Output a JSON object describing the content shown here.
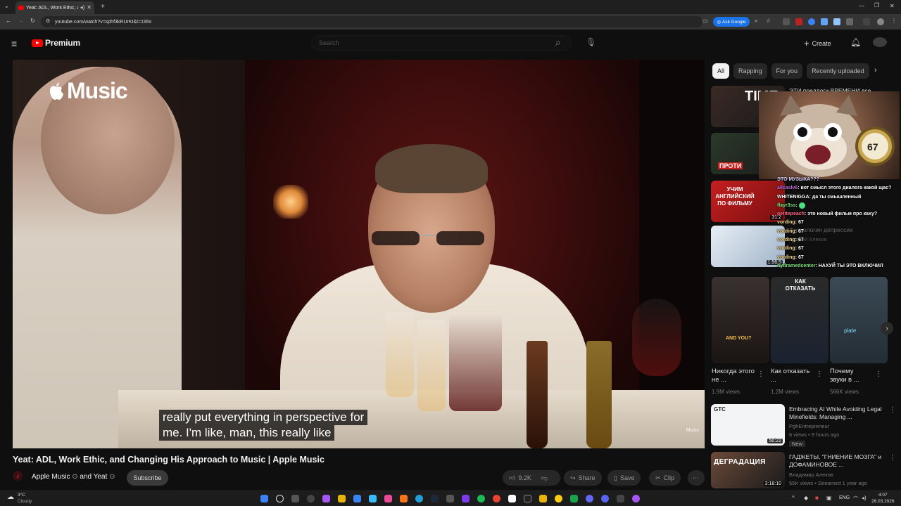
{
  "browser": {
    "tab_title": "Yeat: ADL, Work Ethic, and",
    "url": "youtube.com/watch?v=sphf3kRUrKI&t=195s",
    "ask_google": "Ask Google",
    "new_tab": "+"
  },
  "youtube": {
    "logo_text": "Premium",
    "search_placeholder": "Search",
    "create_label": "Create"
  },
  "player": {
    "overlay_brand": "Music",
    "corner_brand": "Music",
    "caption_line1": "really put everything in perspective for",
    "caption_line2": "me. I'm like, man, this really like"
  },
  "video": {
    "title": "Yeat: ADL, Work Ethic, and Changing His Approach to Music | Apple Music",
    "channel": "Apple Music",
    "collab": "and Yeat",
    "subscribe_label": "Subscribe",
    "likes": "9.2K",
    "share_label": "Share",
    "save_label": "Save",
    "clip_label": "Clip"
  },
  "chips": [
    "All",
    "Rapping",
    "For you",
    "Recently uploaded"
  ],
  "recommendations_top": [
    {
      "title": "ЭТИ предлоги ВРЕМЕНИ все",
      "thumb_text": "TIME"
    },
    {
      "title": "",
      "thumb_text": "ПРОТИ"
    },
    {
      "title": "",
      "thumb_text": "УЧИМ АНГЛИЙСКИЙ ПО ФИЛЬМУ",
      "duration": "31:2"
    },
    {
      "title": "Физиология депрессии",
      "meta": "Андрей Алеков",
      "duration": "1:56:5"
    }
  ],
  "chat": {
    "header": "ЭТО МУЗЫКА???",
    "messages": [
      {
        "user": "allcaslv6",
        "text": "вот смысл этого диалога какой щас?",
        "color": "#c66adf"
      },
      {
        "user": "WHITENIGGA",
        "text": "да ты смышленный",
        "color": "#ffffff"
      },
      {
        "user": "flayr3ss",
        "text": "",
        "color": "#7fe57f"
      },
      {
        "user": "petitepeach",
        "text": "это новый фильм про каху?",
        "color": "#ff6a8c"
      },
      {
        "user": "vording",
        "text": "67",
        "color": "#f5d78a"
      },
      {
        "user": "vording",
        "text": "67",
        "color": "#f5d78a"
      },
      {
        "user": "vording",
        "text": "67",
        "color": "#f5d78a"
      },
      {
        "user": "vording",
        "text": "67",
        "color": "#f5d78a"
      },
      {
        "user": "vording",
        "text": "67",
        "color": "#f5d78a"
      },
      {
        "user": "hydramedcenter",
        "text": "НАХУЙ ТЫ ЭТО ВКЛЮЧИЛ",
        "color": "#7fe57f"
      }
    ]
  },
  "shorts": [
    {
      "title": "Никогда этого не ...",
      "views": "1.9M views",
      "overlay": "AND YOU?"
    },
    {
      "title": "Как отказать ...",
      "views": "1.2M views",
      "overlay": "КАК ОТКАЗАТЬ"
    },
    {
      "title": "Почему звуки в ...",
      "views": "566K views",
      "overlay": "plate"
    }
  ],
  "recommendations_bottom": [
    {
      "title": "Embracing AI While Avoiding Legal Minefields: Managing ...",
      "channel": "PghEntrepreneur",
      "meta": "6 views • 9 hours ago",
      "badge": "New",
      "duration": "50:22",
      "thumb_text": "GTC"
    },
    {
      "title": "ГАДЖЕТЫ, \"ГНИЕНИЕ МОЗГА\" и ДОФАМИНОВОЕ ...",
      "channel": "Владимир Алеков",
      "meta": "55K views • Streamed 1 year ago",
      "duration": "3:18:10",
      "thumb_text": "ДЕГРАДАЦИЯ"
    }
  ],
  "taskbar": {
    "weather_temp": "3°C",
    "weather_desc": "Cloudy",
    "lang": "ENG",
    "time": "4:07",
    "date": "26.03.2026"
  }
}
